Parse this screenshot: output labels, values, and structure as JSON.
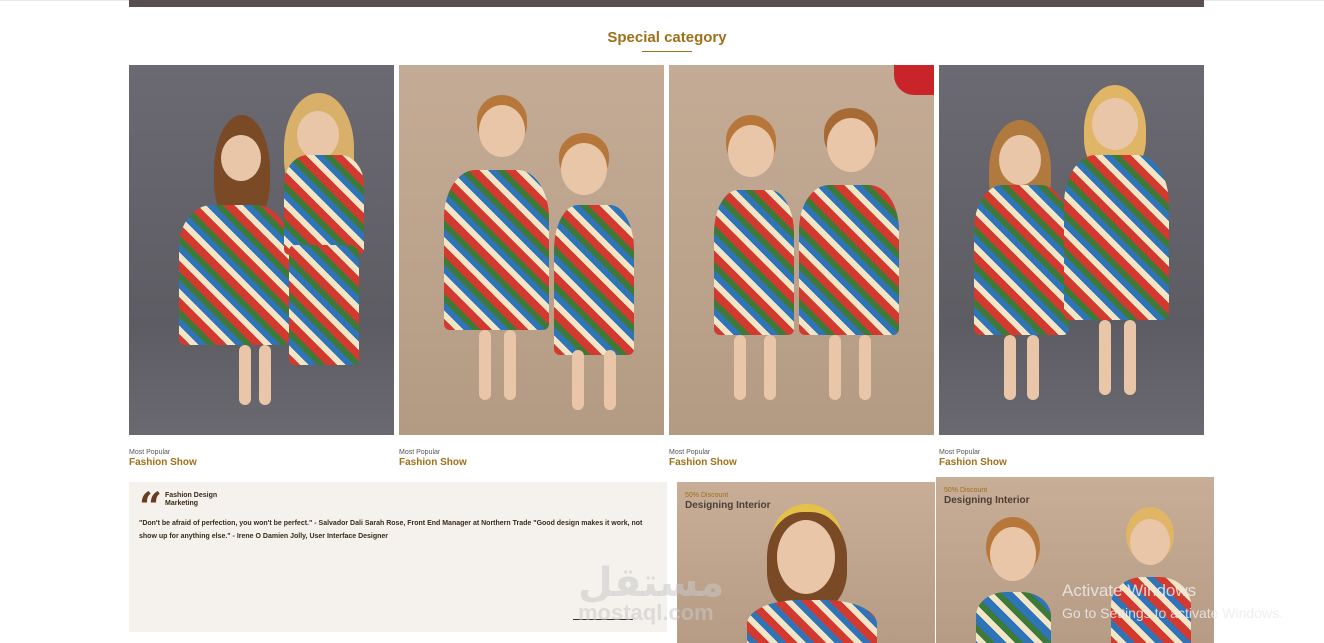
{
  "header": {
    "title": "Special category"
  },
  "cards": [
    {
      "subtitle": "Most Popular",
      "title": "Fashion Show"
    },
    {
      "subtitle": "Most Popular",
      "title": "Fashion Show"
    },
    {
      "subtitle": "Most Popular",
      "title": "Fashion Show"
    },
    {
      "subtitle": "Most Popular",
      "title": "Fashion Show"
    }
  ],
  "quote": {
    "heading": "Fashion Design Marketing",
    "text": "\"Don't be afraid of perfection, you won't be perfect.\" - Salvador Dali Sarah Rose, Front End Manager at Northern Trade \"Good design makes it work, not show up for anything else.\" - Irene O Damien Jolly, User Interface Designer"
  },
  "promos": [
    {
      "discount": "50% Discount",
      "title": "Designing Interior"
    },
    {
      "discount": "50% Discount",
      "title": "Designing Interior"
    }
  ],
  "watermark": {
    "arabic": "مستقل",
    "latin": "mostaql.com"
  },
  "os_notice": {
    "line1": "Activate Windows",
    "line2": "Go to Settings to activate Windows."
  },
  "colors": {
    "accent": "#a06f1a",
    "quote_bg": "#f5f2ed"
  }
}
